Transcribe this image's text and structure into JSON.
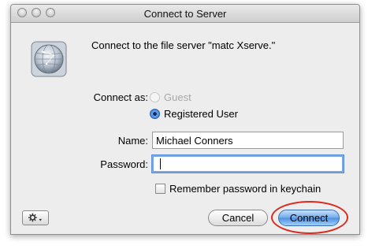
{
  "window": {
    "title": "Connect to Server"
  },
  "dialog": {
    "message": "Connect to the file server \"matc Xserve.\"",
    "connect_as_label": "Connect as:",
    "options": [
      "Guest",
      "Registered User"
    ],
    "selected_option": "Registered User",
    "name_label": "Name:",
    "name_value": "Michael Conners",
    "password_label": "Password:",
    "password_value": "",
    "remember_label": "Remember password in keychain",
    "remember_checked": false
  },
  "buttons": {
    "cancel": "Cancel",
    "connect": "Connect"
  },
  "icons": {
    "server": "globe-server-icon",
    "action": "gear-menu-icon"
  },
  "colors": {
    "default_button": "#4c8fe0",
    "highlight_circle": "#d92a1d",
    "focus_ring": "#7ba7e1"
  }
}
